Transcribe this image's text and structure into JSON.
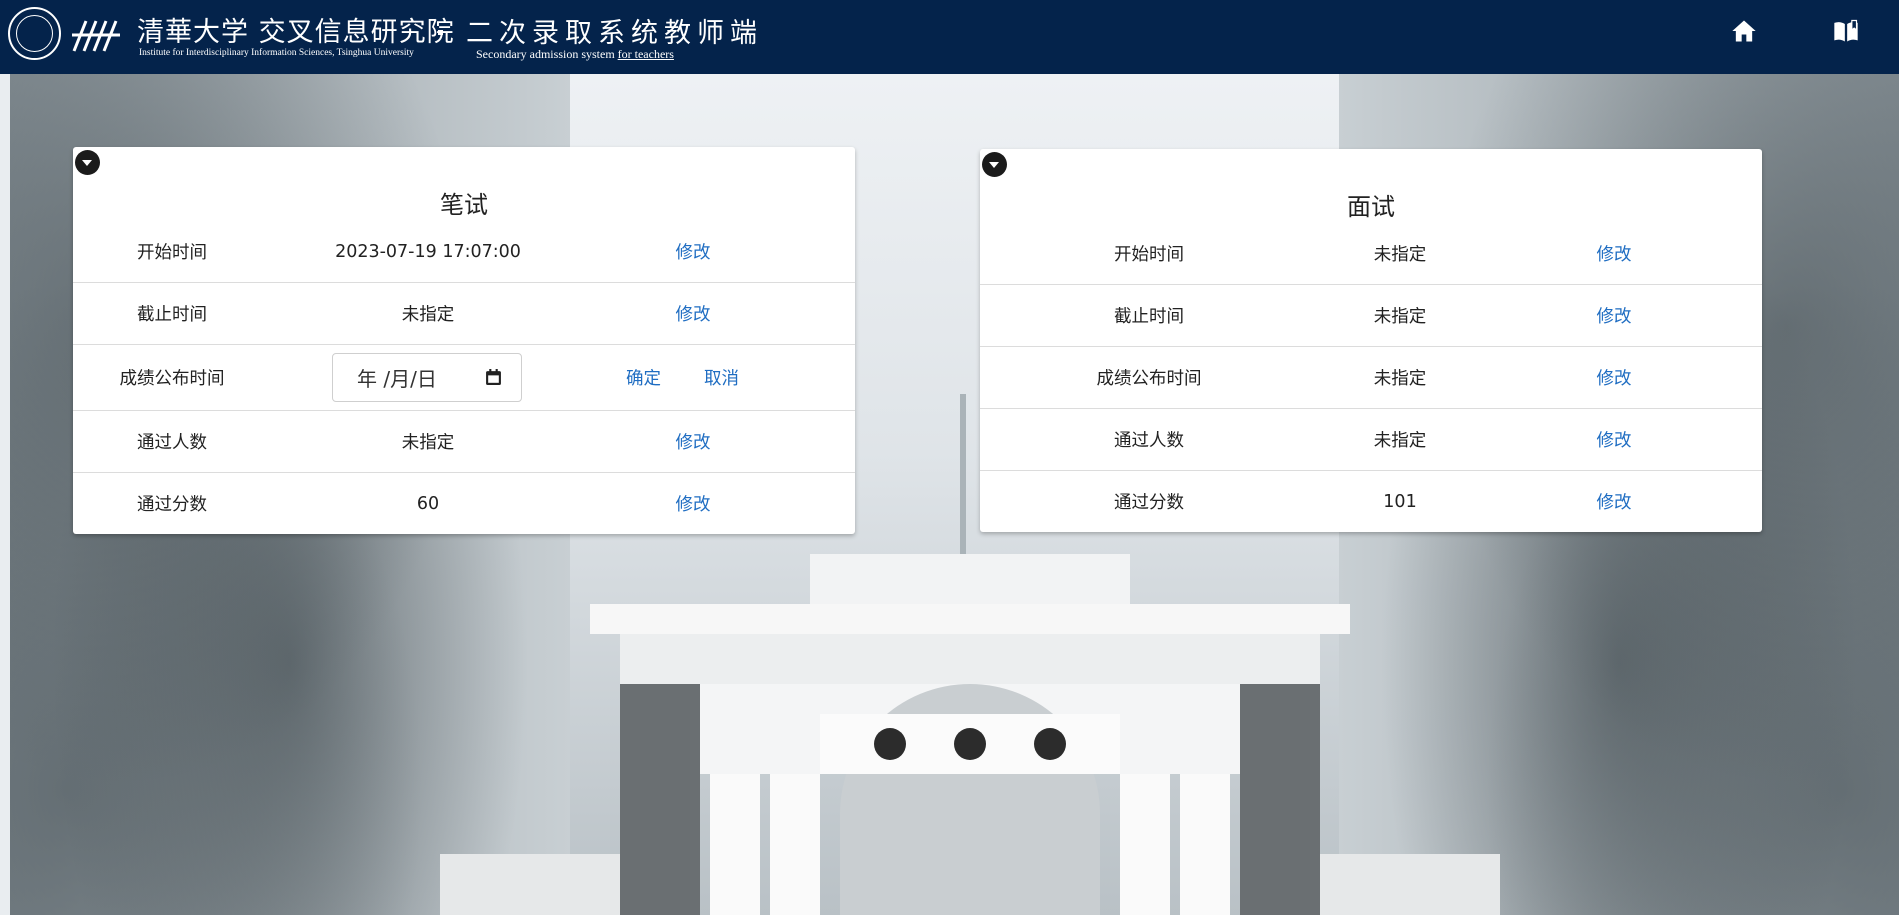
{
  "header": {
    "brand_cn": "清華大学 交叉信息研究院",
    "brand_en": "Institute for Interdisciplinary Information Sciences, Tsinghua University",
    "system_cn": "二次录取系统教师端",
    "system_en_prefix": "Secondary admission system ",
    "system_en_suffix": "for teachers"
  },
  "written": {
    "title": "笔试",
    "rows": [
      {
        "label": "开始时间",
        "value": "2023-07-19 17:07:00",
        "action": "修改"
      },
      {
        "label": "截止时间",
        "value": "未指定",
        "action": "修改"
      },
      {
        "label": "成绩公布时间",
        "date_placeholder": "年 /月/日",
        "confirm": "确定",
        "cancel": "取消"
      },
      {
        "label": "通过人数",
        "value": "未指定",
        "action": "修改"
      },
      {
        "label": "通过分数",
        "value": "60",
        "action": "修改"
      }
    ]
  },
  "interview": {
    "title": "面试",
    "rows": [
      {
        "label": "开始时间",
        "value": "未指定",
        "action": "修改"
      },
      {
        "label": "截止时间",
        "value": "未指定",
        "action": "修改"
      },
      {
        "label": "成绩公布时间",
        "value": "未指定",
        "action": "修改"
      },
      {
        "label": "通过人数",
        "value": "未指定",
        "action": "修改"
      },
      {
        "label": "通过分数",
        "value": "101",
        "action": "修改"
      }
    ]
  },
  "colors": {
    "navbar": "#04234b",
    "link": "#1f6dc2"
  },
  "icons": [
    "university-seal-icon",
    "home-icon",
    "book-icon",
    "collapse-toggle-icon",
    "calendar-icon"
  ]
}
